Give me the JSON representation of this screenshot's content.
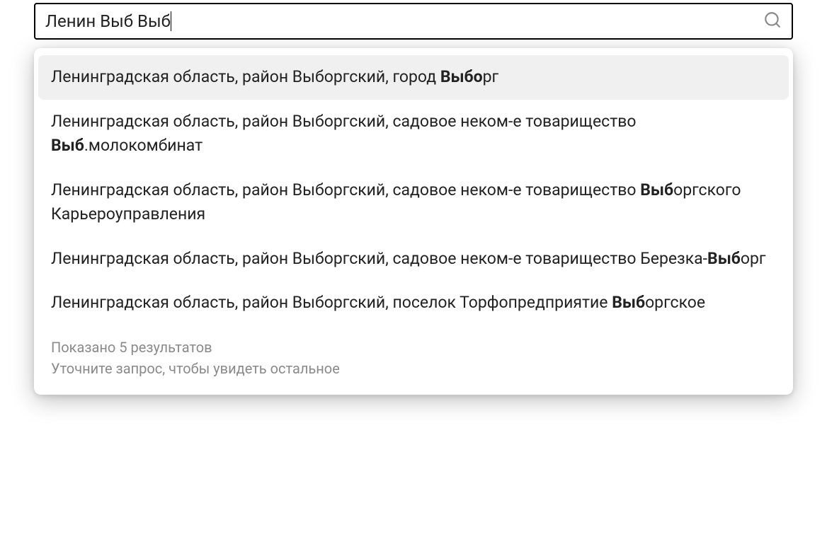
{
  "search": {
    "value": "Ленин Выб Выб"
  },
  "suggestions": [
    {
      "segments": [
        {
          "t": "Ленинградская область, район Выборгский, город ",
          "b": false
        },
        {
          "t": "Выбо",
          "b": true
        },
        {
          "t": "рг",
          "b": false
        }
      ],
      "highlighted": true
    },
    {
      "segments": [
        {
          "t": "Ленинградская область, район Выборгский, садовое неком-е товарищество ",
          "b": false
        },
        {
          "t": "Выб",
          "b": true
        },
        {
          "t": ".молокомбинат",
          "b": false
        }
      ],
      "highlighted": false
    },
    {
      "segments": [
        {
          "t": "Ленинградская область, район Выборгский, садовое неком-е товарищество ",
          "b": false
        },
        {
          "t": "Выб",
          "b": true
        },
        {
          "t": "оргского Карьероуправления",
          "b": false
        }
      ],
      "highlighted": false
    },
    {
      "segments": [
        {
          "t": "Ленинградская область, район Выборгский, садовое неком-е товарищество Березка-",
          "b": false
        },
        {
          "t": "Выб",
          "b": true
        },
        {
          "t": "орг",
          "b": false
        }
      ],
      "highlighted": false
    },
    {
      "segments": [
        {
          "t": "Ленинградская область, район Выборгский, поселок Торфопредприятие ",
          "b": false
        },
        {
          "t": "Выб",
          "b": true
        },
        {
          "t": "оргское",
          "b": false
        }
      ],
      "highlighted": false
    }
  ],
  "footer": {
    "line1": "Показано 5 результатов",
    "line2": "Уточните запрос, чтобы увидеть остальное"
  }
}
